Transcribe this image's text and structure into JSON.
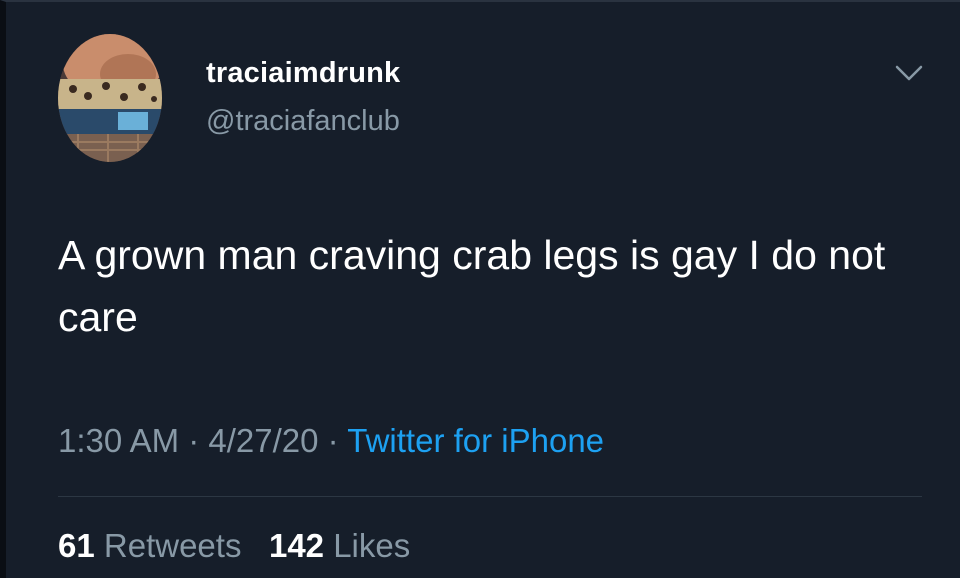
{
  "tweet": {
    "user": {
      "display_name": "traciaimdrunk",
      "handle": "@traciafanclub"
    },
    "text": "A grown man craving crab legs is gay I do not care",
    "meta": {
      "time": "1:30 AM",
      "separator1": " · ",
      "date": "4/27/20",
      "separator2": " · ",
      "source": "Twitter for iPhone"
    },
    "stats": {
      "retweets_count": "61",
      "retweets_label": "Retweets",
      "likes_count": "142",
      "likes_label": "Likes"
    },
    "icons": {
      "menu": "chevron-down-icon"
    },
    "colors": {
      "background": "#161e2a",
      "primary_text": "#ffffff",
      "secondary_text": "#8899a6",
      "link": "#1da1f2"
    }
  }
}
